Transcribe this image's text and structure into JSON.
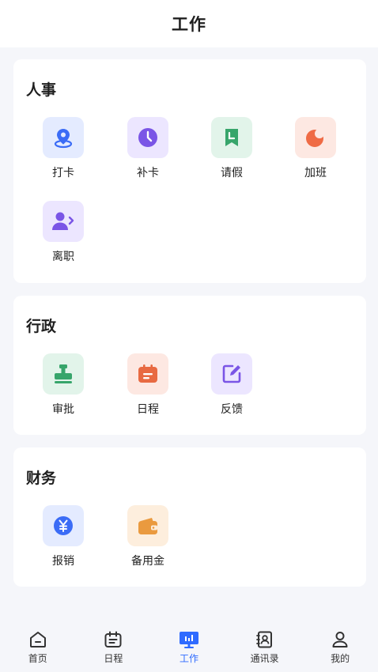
{
  "header": {
    "title": "工作"
  },
  "sections": [
    {
      "title": "人事",
      "items": [
        {
          "label": "打卡",
          "icon": "location-pin-icon",
          "bg": "#e4ebff",
          "fg": "#3b6cf6"
        },
        {
          "label": "补卡",
          "icon": "clock-icon",
          "bg": "#ece6ff",
          "fg": "#7a55e6"
        },
        {
          "label": "请假",
          "icon": "bookmark-icon",
          "bg": "#e2f4ea",
          "fg": "#37a56b"
        },
        {
          "label": "加班",
          "icon": "moon-icon",
          "bg": "#fde8e2",
          "fg": "#ef6b45"
        },
        {
          "label": "离职",
          "icon": "user-leave-icon",
          "bg": "#ece6ff",
          "fg": "#7a55e6"
        }
      ]
    },
    {
      "title": "行政",
      "items": [
        {
          "label": "审批",
          "icon": "stamp-icon",
          "bg": "#e2f4ea",
          "fg": "#37a56b"
        },
        {
          "label": "日程",
          "icon": "calendar-icon",
          "bg": "#fde8e2",
          "fg": "#e86a42"
        },
        {
          "label": "反馈",
          "icon": "edit-icon",
          "bg": "#ece6ff",
          "fg": "#7a55e6"
        }
      ]
    },
    {
      "title": "财务",
      "items": [
        {
          "label": "报销",
          "icon": "yuan-icon",
          "bg": "#e4ebff",
          "fg": "#3b6cf6"
        },
        {
          "label": "备用金",
          "icon": "wallet-icon",
          "bg": "#fdeedd",
          "fg": "#ea9a3f"
        }
      ]
    }
  ],
  "tabbar": {
    "active_color": "#2f6bff",
    "items": [
      {
        "label": "首页",
        "icon": "home-icon"
      },
      {
        "label": "日程",
        "icon": "calendar-icon"
      },
      {
        "label": "工作",
        "icon": "work-chart-icon",
        "active": true
      },
      {
        "label": "通讯录",
        "icon": "contacts-icon"
      },
      {
        "label": "我的",
        "icon": "user-icon"
      }
    ]
  }
}
